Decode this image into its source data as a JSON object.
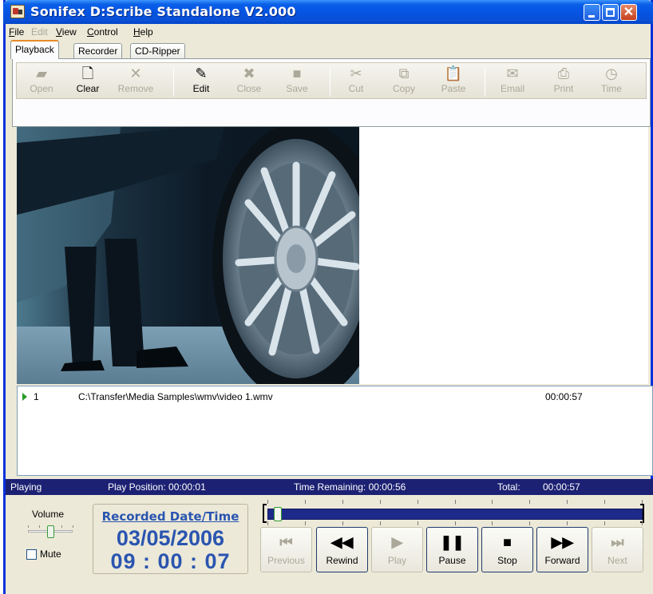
{
  "window": {
    "title": "Sonifex D:Scribe Standalone V2.000",
    "minimize_glyph": "",
    "maximize_glyph": "",
    "close_glyph": "✕"
  },
  "menu": {
    "file": "F",
    "file_rest": "ile",
    "edit": "Edit",
    "view": "V",
    "view_rest": "iew",
    "control": "C",
    "control_rest": "ontrol",
    "help": "H",
    "help_rest": "elp"
  },
  "tabs": {
    "playback": "Playback",
    "recorder": "Recorder",
    "cd_ripper": "CD-Ripper"
  },
  "toolbar": {
    "open": "Open",
    "clear": "Clear",
    "remove": "Remove",
    "edit": "Edit",
    "close": "Close",
    "save": "Save",
    "cut": "Cut",
    "copy": "Copy",
    "paste": "Paste",
    "email": "Email",
    "print": "Print",
    "time": "Time",
    "icons": {
      "open": "▰",
      "clear": "🗋",
      "remove": "✕",
      "edit": "✎",
      "close": "✖",
      "save": "■",
      "cut": "✂",
      "copy": "⧉",
      "paste": "📋",
      "email": "✉",
      "print": "⎙",
      "time": "◷"
    }
  },
  "playlist": {
    "items": [
      {
        "number": "1",
        "path": "C:\\Transfer\\Media Samples\\wmv\\video 1.wmv",
        "duration": "00:00:57"
      }
    ]
  },
  "status": {
    "state": "Playing",
    "play_position": "Play Position: 00:00:01",
    "time_remaining": "Time Remaining: 00:00:56",
    "total_label": "Total:",
    "total_value": "00:00:57"
  },
  "volume": {
    "label": "Volume",
    "level": 0.5,
    "mute_label": "Mute",
    "muted": false
  },
  "recorded": {
    "title": "Recorded Date/Time",
    "date": "03/05/2006",
    "time": "09 : 00 : 07"
  },
  "position": {
    "fraction": 0.0175
  },
  "controls": {
    "previous": "Previous",
    "rewind": "Rewind",
    "play": "Play",
    "pause": "Pause",
    "stop": "Stop",
    "forward": "Forward",
    "next": "Next",
    "icons": {
      "previous": "⏮",
      "rewind": "◀◀",
      "play": "▶",
      "pause": "❚❚",
      "stop": "■",
      "forward": "▶▶",
      "next": "⏭"
    }
  }
}
